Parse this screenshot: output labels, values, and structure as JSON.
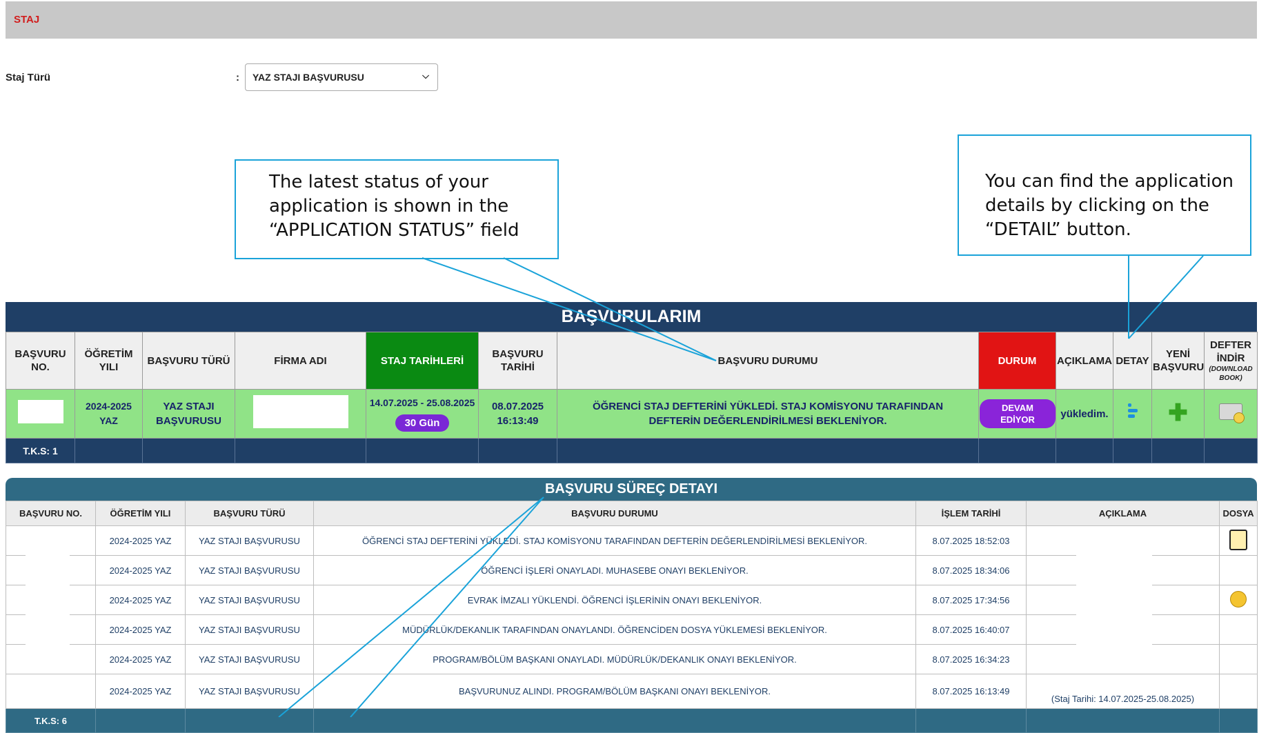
{
  "header": {
    "title": "STAJ"
  },
  "filter": {
    "label": "Staj Türü",
    "colon": ":",
    "selected": "YAZ STAJI BAŞVURUSU"
  },
  "callouts": {
    "status": "The latest status of your application is shown in the “APPLICATION STATUS” field",
    "detail": "You can find the application details by clicking on the “DETAIL” button."
  },
  "applications": {
    "title": "BAŞVURULARIM",
    "headers": {
      "no": "BAŞVURU NO.",
      "year": "ÖĞRETİM YILI",
      "type": "BAŞVURU TÜRÜ",
      "company": "FİRMA ADI",
      "dates": "STAJ TARİHLERİ",
      "app_date": "BAŞVURU TARİHİ",
      "status": "BAŞVURU DURUMU",
      "state": "DURUM",
      "note": "AÇIKLAMA",
      "detail": "DETAY",
      "new": "YENİ BAŞVURU",
      "book": "DEFTER İNDİR",
      "book_sub": "(DOWNLOAD BOOK)"
    },
    "row": {
      "year": "2024-2025 YAZ",
      "type": "YAZ STAJI BAŞVURUSU",
      "dates": "14.07.2025 - 25.08.2025",
      "days": "30 Gün",
      "app_date": "08.07.2025",
      "app_time": "16:13:49",
      "status": "ÖĞRENCİ STAJ DEFTERİNİ YÜKLEDİ. STAJ KOMİSYONU TARAFINDAN DEFTERİN DEĞERLENDİRİLMESİ BEKLENİYOR.",
      "state": "DEVAM EDİYOR",
      "note": "yükledim.",
      "detail_icon": "detail-icon",
      "new_icon": "plus-icon",
      "book_icon": "book-download-icon"
    },
    "footer": "T.K.S: 1",
    "colors": {
      "title_bg": "#1f3f66",
      "row_bg": "#90e387",
      "dates_bg": "#0a8a12",
      "state_bg": "#e11414",
      "pill": "#8a24d9"
    }
  },
  "process": {
    "title": "BAŞVURU SÜREÇ DETAYI",
    "headers": [
      "BAŞVURU NO.",
      "ÖĞRETİM YILI",
      "BAŞVURU TÜRÜ",
      "BAŞVURU DURUMU",
      "İŞLEM TARİHİ",
      "AÇIKLAMA",
      "DOSYA"
    ],
    "rows": [
      {
        "year": "2024-2025 YAZ",
        "type": "YAZ STAJI BAŞVURUSU",
        "status": "ÖĞRENCİ STAJ DEFTERİNİ YÜKLEDİ. STAJ KOMİSYONU TARAFINDAN DEFTERİN DEĞERLENDİRİLMESİ BEKLENİYOR.",
        "date": "8.07.2025 18:52:03",
        "note": ""
      },
      {
        "year": "2024-2025 YAZ",
        "type": "YAZ STAJI BAŞVURUSU",
        "status": "ÖĞRENCİ İŞLERİ ONAYLADI. MUHASEBE ONAYI BEKLENİYOR.",
        "date": "8.07.2025 18:34:06",
        "note": ""
      },
      {
        "year": "2024-2025 YAZ",
        "type": "YAZ STAJI BAŞVURUSU",
        "status": "EVRAK İMZALI YÜKLENDİ. ÖĞRENCİ İŞLERİNİN ONAYI BEKLENİYOR.",
        "date": "8.07.2025 17:34:56",
        "note": ""
      },
      {
        "year": "2024-2025 YAZ",
        "type": "YAZ STAJI BAŞVURUSU",
        "status": "MÜDÜRLÜK/DEKANLIK TARAFINDAN ONAYLANDI. ÖĞRENCİDEN DOSYA YÜKLEMESİ BEKLENİYOR.",
        "date": "8.07.2025 16:40:07",
        "note": ""
      },
      {
        "year": "2024-2025 YAZ",
        "type": "YAZ STAJI BAŞVURUSU",
        "status": "PROGRAM/BÖLÜM BAŞKANI ONAYLADI. MÜDÜRLÜK/DEKANLIK ONAYI BEKLENİYOR.",
        "date": "8.07.2025 16:34:23",
        "note": ""
      },
      {
        "year": "2024-2025 YAZ",
        "type": "YAZ STAJI BAŞVURUSU",
        "status": "BAŞVURUNUZ ALINDI. PROGRAM/BÖLÜM BAŞKANI ONAYI BEKLENİYOR.",
        "date": "8.07.2025 16:13:49",
        "note": "(Staj Tarihi: 14.07.2025-25.08.2025)"
      }
    ],
    "footer": "T.K.S: 6"
  }
}
